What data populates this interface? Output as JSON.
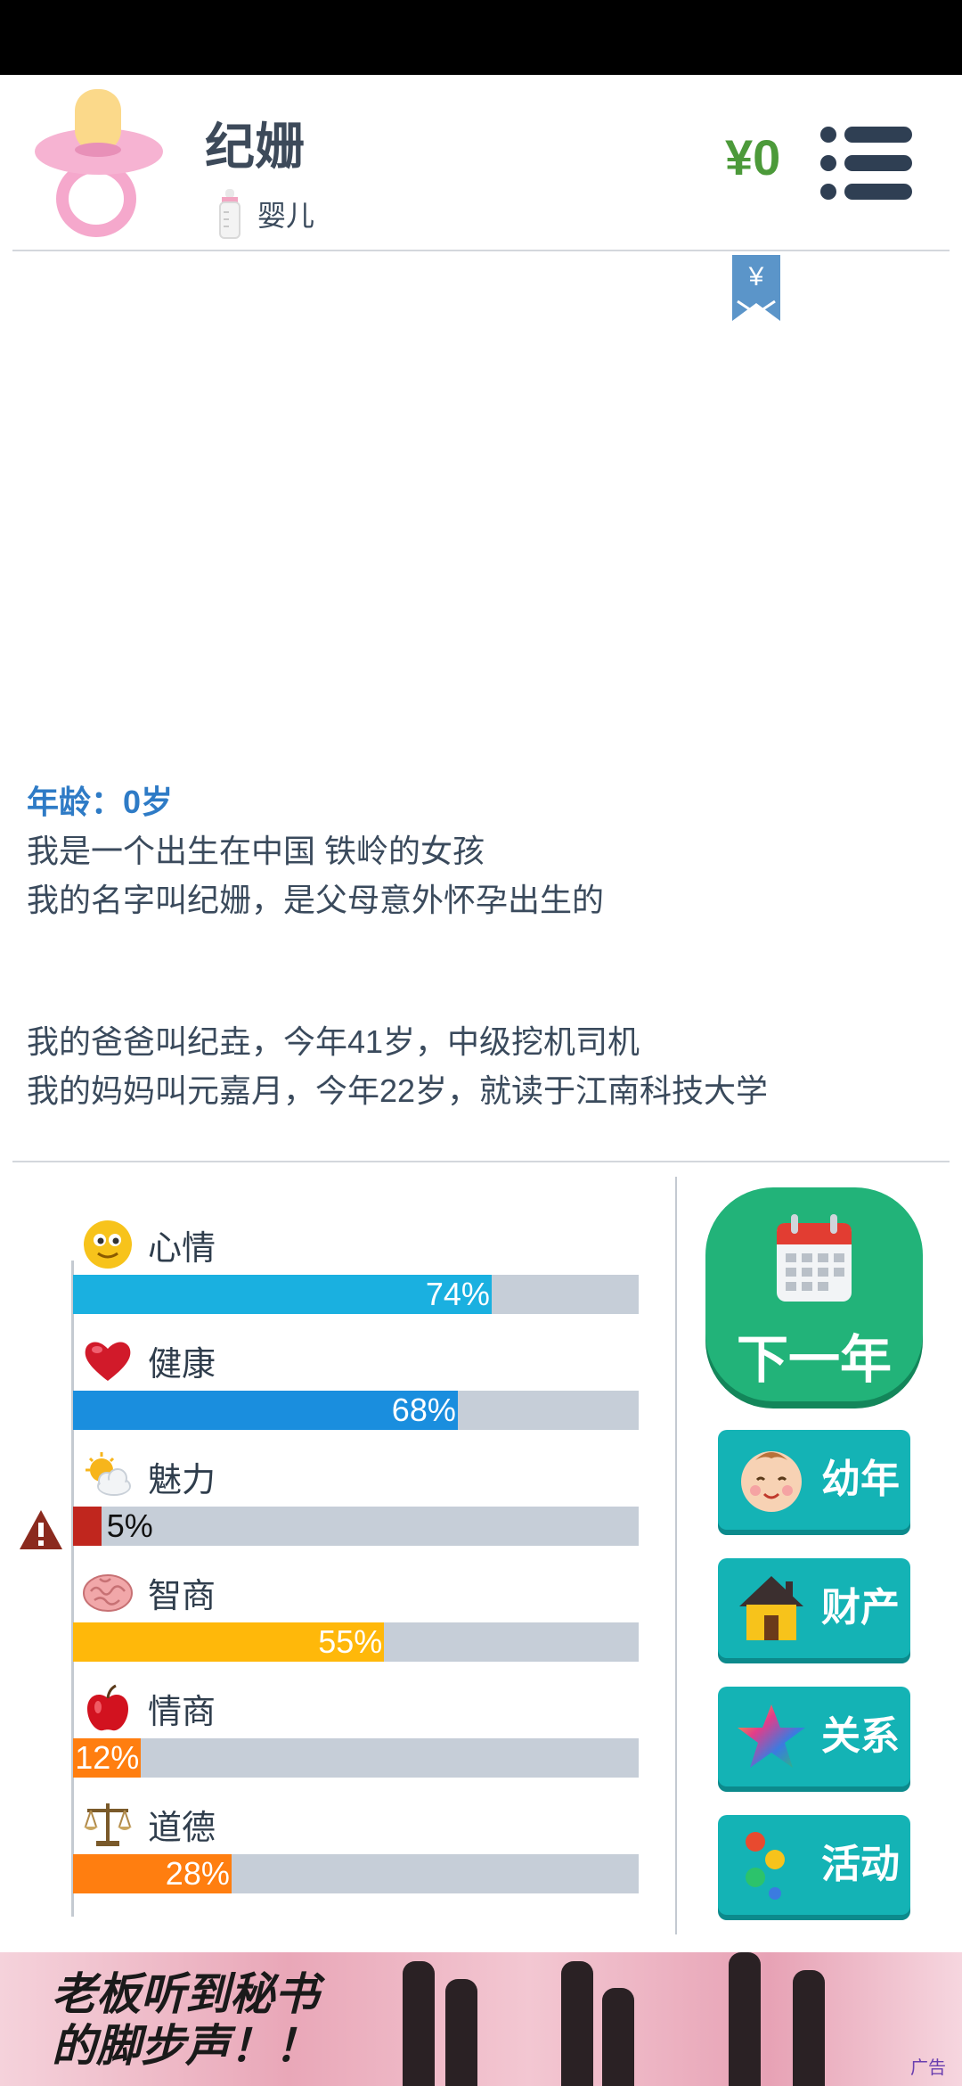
{
  "header": {
    "name": "纪姗",
    "stage": "婴儿",
    "money": "¥0",
    "bookmark_symbol": "¥"
  },
  "story": {
    "age_line": "年龄：0岁",
    "lines_1": [
      "我是一个出生在中国 铁岭的女孩",
      "我的名字叫纪姗，是父母意外怀孕出生的"
    ],
    "lines_2": [
      "我的爸爸叫纪垚，今年41岁，中级挖机司机",
      "我的妈妈叫元嘉月，今年22岁，就读于江南科技大学"
    ]
  },
  "stats": [
    {
      "key": "mood",
      "label": "心情",
      "value": 74,
      "text": "74%",
      "color": "#1ab0e0",
      "icon": "smiley-icon"
    },
    {
      "key": "health",
      "label": "健康",
      "value": 68,
      "text": "68%",
      "color": "#1a8ede",
      "icon": "heart-icon"
    },
    {
      "key": "charm",
      "label": "魅力",
      "value": 5,
      "text": "5%",
      "color": "#c0261e",
      "icon": "weather-icon",
      "warning": true
    },
    {
      "key": "iq",
      "label": "智商",
      "value": 55,
      "text": "55%",
      "color": "#ffb80a",
      "icon": "brain-icon"
    },
    {
      "key": "eq",
      "label": "情商",
      "value": 12,
      "text": "12%",
      "color": "#ff7e10",
      "icon": "apple-icon"
    },
    {
      "key": "morality",
      "label": "道德",
      "value": 28,
      "text": "28%",
      "color": "#ff7e10",
      "icon": "scales-icon"
    }
  ],
  "actions": {
    "next_year": "下一年",
    "childhood": "幼年",
    "assets": "财产",
    "relations": "关系",
    "activities": "活动"
  },
  "ad": {
    "line1": "老板听到秘书",
    "line2": "的脚步声！！",
    "tag": "广告"
  }
}
